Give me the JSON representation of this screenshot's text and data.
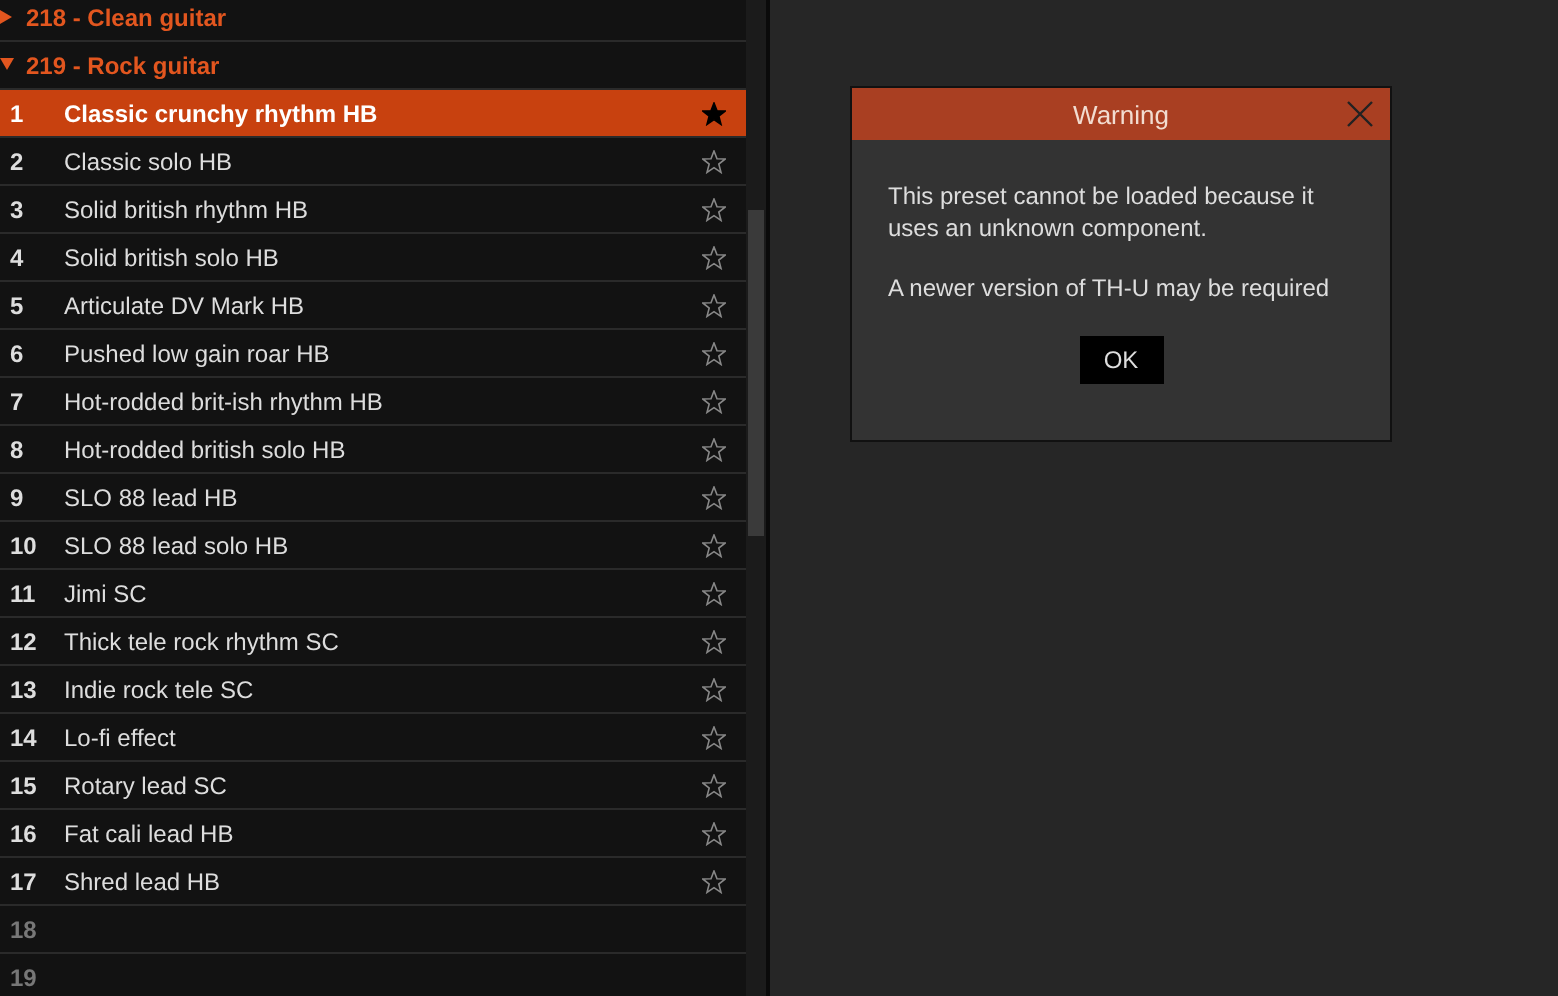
{
  "groups": [
    {
      "title": "218 - Clean guitar",
      "expanded": false
    },
    {
      "title": "219 - Rock guitar",
      "expanded": true,
      "presets": [
        {
          "kind": "preset",
          "number": "1",
          "name": "Classic crunchy rhythm HB",
          "selected": true,
          "favorite": true
        },
        {
          "kind": "preset",
          "number": "2",
          "name": "Classic solo HB",
          "selected": false,
          "favorite": false
        },
        {
          "kind": "preset",
          "number": "3",
          "name": "Solid british rhythm HB",
          "selected": false,
          "favorite": false
        },
        {
          "kind": "preset",
          "number": "4",
          "name": "Solid british solo HB",
          "selected": false,
          "favorite": false
        },
        {
          "kind": "preset",
          "number": "5",
          "name": "Articulate DV Mark HB",
          "selected": false,
          "favorite": false
        },
        {
          "kind": "preset",
          "number": "6",
          "name": "Pushed low gain roar HB",
          "selected": false,
          "favorite": false
        },
        {
          "kind": "preset",
          "number": "7",
          "name": "Hot-rodded brit-ish rhythm HB",
          "selected": false,
          "favorite": false
        },
        {
          "kind": "preset",
          "number": "8",
          "name": "Hot-rodded british solo HB",
          "selected": false,
          "favorite": false
        },
        {
          "kind": "preset",
          "number": "9",
          "name": "SLO 88 lead HB",
          "selected": false,
          "favorite": false
        },
        {
          "kind": "preset",
          "number": "10",
          "name": "SLO 88 lead solo HB",
          "selected": false,
          "favorite": false
        },
        {
          "kind": "preset",
          "number": "11",
          "name": "Jimi SC",
          "selected": false,
          "favorite": false
        },
        {
          "kind": "preset",
          "number": "12",
          "name": "Thick tele rock rhythm SC",
          "selected": false,
          "favorite": false
        },
        {
          "kind": "preset",
          "number": "13",
          "name": "Indie rock tele SC",
          "selected": false,
          "favorite": false
        },
        {
          "kind": "preset",
          "number": "14",
          "name": "Lo-fi effect",
          "selected": false,
          "favorite": false
        },
        {
          "kind": "preset",
          "number": "15",
          "name": "Rotary lead SC",
          "selected": false,
          "favorite": false
        },
        {
          "kind": "preset",
          "number": "16",
          "name": "Fat cali lead HB",
          "selected": false,
          "favorite": false
        },
        {
          "kind": "preset",
          "number": "17",
          "name": "Shred lead HB",
          "selected": false,
          "favorite": false
        },
        {
          "kind": "empty",
          "number": "18",
          "selected": false
        },
        {
          "kind": "empty",
          "number": "19",
          "selected": false
        }
      ]
    }
  ],
  "dialog": {
    "title": "Warning",
    "paragraphs": [
      "This preset cannot be loaded because it uses an unknown component.",
      "A newer version of TH-U may be required"
    ],
    "button": "OK"
  }
}
